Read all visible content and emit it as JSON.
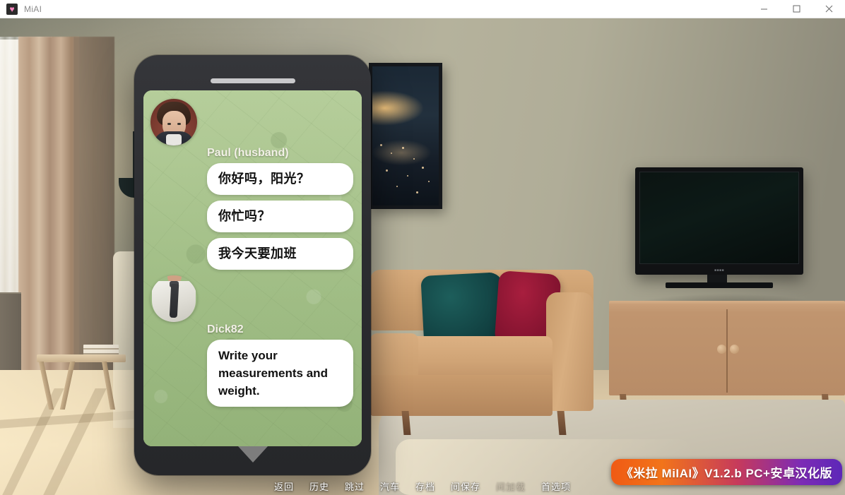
{
  "window": {
    "title": "MiAI",
    "app_icon": "heart-icon",
    "accent_color": "#f886c0",
    "controls": [
      {
        "name": "minimize",
        "glyph": "minimize-icon"
      },
      {
        "name": "maximize",
        "glyph": "maximize-icon"
      },
      {
        "name": "close",
        "glyph": "close-icon"
      }
    ]
  },
  "phone": {
    "screen_bg_color": "#a6c68a",
    "bubble_color": "#ffffff",
    "sender_color": "#f2f0e6",
    "scroll_indicator": "down-triangle-icon",
    "conversations": [
      {
        "sender": "Paul (husband)",
        "avatar": "paul-avatar",
        "messages": [
          "你好吗，阳光？",
          "你忙吗？",
          "我今天要加班"
        ]
      },
      {
        "sender": "Dick82",
        "avatar": "dick82-avatar",
        "messages": [
          "Write your measurements and weight."
        ]
      }
    ]
  },
  "quick_menu": {
    "items": [
      {
        "label": "返回",
        "enabled": true
      },
      {
        "label": "历史",
        "enabled": true
      },
      {
        "label": "跳过",
        "enabled": true
      },
      {
        "label": "汽车",
        "enabled": true
      },
      {
        "label": "存档",
        "enabled": true
      },
      {
        "label": "间保存",
        "enabled": true
      },
      {
        "label": "间加载",
        "enabled": false
      },
      {
        "label": "首选项",
        "enabled": true
      }
    ]
  },
  "watermark": {
    "text": "《米拉 MiIAI》V1.2.b PC+安卓汉化版",
    "gradient_start": "#f05a14",
    "gradient_end": "#5d27b8"
  },
  "scene": {
    "description": "living-room-background",
    "elements": [
      "window-with-curtains",
      "floor-lamp",
      "wooden-bench-with-books",
      "framed-night-cityscape-picture",
      "tan-leather-sofa",
      "teal-pillow",
      "crimson-pillow",
      "flat-screen-tv",
      "wooden-credenza",
      "area-rug"
    ]
  }
}
